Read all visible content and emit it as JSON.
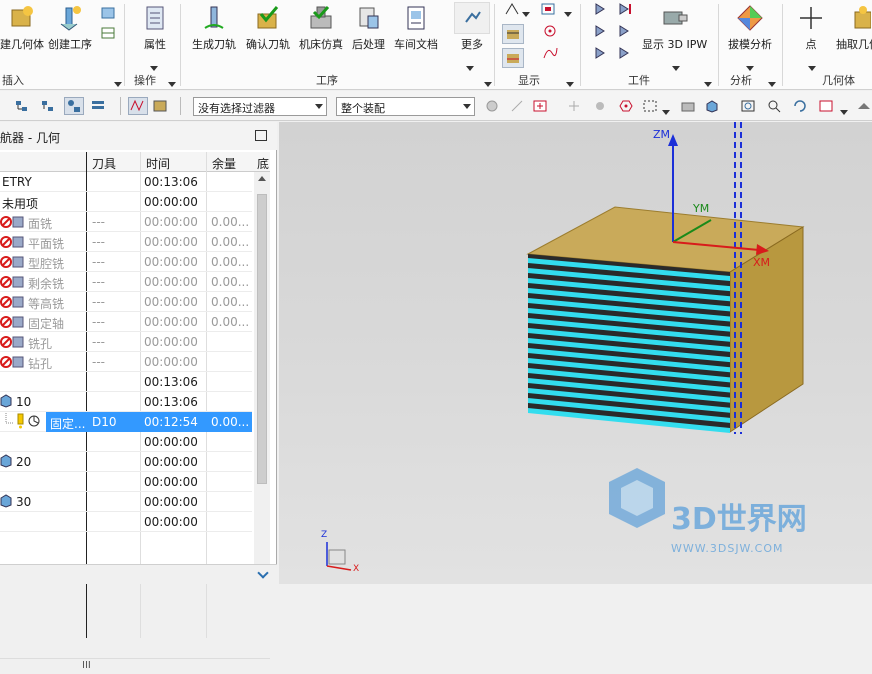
{
  "ribbon": {
    "buttons": [
      {
        "name": "create-geometry-button",
        "label": "建几何体"
      },
      {
        "name": "create-operation-button",
        "label": "创建工序"
      },
      {
        "name": "properties-button",
        "label": "属性"
      },
      {
        "name": "generate-toolpath-button",
        "label": "生成刀轨"
      },
      {
        "name": "verify-toolpath-button",
        "label": "确认刀轨"
      },
      {
        "name": "machine-simulation-button",
        "label": "机床仿真"
      },
      {
        "name": "postprocess-button",
        "label": "后处理"
      },
      {
        "name": "shop-document-button",
        "label": "车间文档"
      },
      {
        "name": "more-button",
        "label": "更多"
      },
      {
        "name": "display-3d-ipw-button",
        "label": "显示 3D IPW"
      },
      {
        "name": "draft-analysis-button",
        "label": "拔模分析"
      },
      {
        "name": "point-button",
        "label": "点"
      },
      {
        "name": "extract-geometry-button",
        "label": "抽取几何"
      }
    ],
    "groups": {
      "insert": "插入",
      "operations": "操作",
      "process": "工序",
      "display": "显示",
      "tools": "工件",
      "analysis": "分析",
      "geometry": "几何体"
    }
  },
  "toolbar": {
    "filter_value": "没有选择过滤器",
    "assembly_value": "整个装配"
  },
  "navigator": {
    "title": "航器 - 几何",
    "columns": [
      "刀具",
      "时间",
      "余量",
      "底"
    ],
    "rows": [
      {
        "name": "ETRY",
        "tool": "",
        "time": "00:13:06",
        "stock": "",
        "dim": false
      },
      {
        "name": "未用项",
        "tool": "",
        "time": "00:00:00",
        "stock": "",
        "dim": false
      },
      {
        "name": "面铣",
        "tool": "---",
        "time": "00:00:00",
        "stock": "0.00...",
        "dim": true
      },
      {
        "name": "平面铣",
        "tool": "---",
        "time": "00:00:00",
        "stock": "0.00...",
        "dim": true
      },
      {
        "name": "型腔铣",
        "tool": "---",
        "time": "00:00:00",
        "stock": "0.00...",
        "dim": true
      },
      {
        "name": "剩余铣",
        "tool": "---",
        "time": "00:00:00",
        "stock": "0.00...",
        "dim": true
      },
      {
        "name": "等高铣",
        "tool": "---",
        "time": "00:00:00",
        "stock": "0.00...",
        "dim": true
      },
      {
        "name": "固定轴",
        "tool": "---",
        "time": "00:00:00",
        "stock": "0.00...",
        "dim": true
      },
      {
        "name": "铣孔",
        "tool": "---",
        "time": "00:00:00",
        "stock": "",
        "dim": true
      },
      {
        "name": "钻孔",
        "tool": "---",
        "time": "00:00:00",
        "stock": "",
        "dim": true
      },
      {
        "name": "",
        "tool": "",
        "time": "00:13:06",
        "stock": "",
        "dim": false
      },
      {
        "name": "10",
        "tool": "",
        "time": "00:13:06",
        "stock": "",
        "dim": false
      },
      {
        "name": "固定...",
        "tool": "D10",
        "time": "00:12:54",
        "stock": "0.00...",
        "dim": false
      },
      {
        "name": "",
        "tool": "",
        "time": "00:00:00",
        "stock": "",
        "dim": false
      },
      {
        "name": "20",
        "tool": "",
        "time": "00:00:00",
        "stock": "",
        "dim": false
      },
      {
        "name": "",
        "tool": "",
        "time": "00:00:00",
        "stock": "",
        "dim": false
      },
      {
        "name": "30",
        "tool": "",
        "time": "00:00:00",
        "stock": "",
        "dim": false
      },
      {
        "name": "",
        "tool": "",
        "time": "00:00:00",
        "stock": "",
        "dim": false
      }
    ],
    "hscroll_label": "III"
  },
  "viewport": {
    "axis_zm": "ZM",
    "axis_ym": "YM",
    "axis_xm": "XM",
    "triad_z": "Z",
    "triad_x": "X",
    "watermark_text": "3D世界网",
    "watermark_url": "WWW.3DSJW.COM"
  },
  "colors": {
    "stock_top": "#c9aa5a",
    "stock_front": "#b8983f",
    "toolpath": "#33ddee",
    "selection": "#3399ff"
  }
}
